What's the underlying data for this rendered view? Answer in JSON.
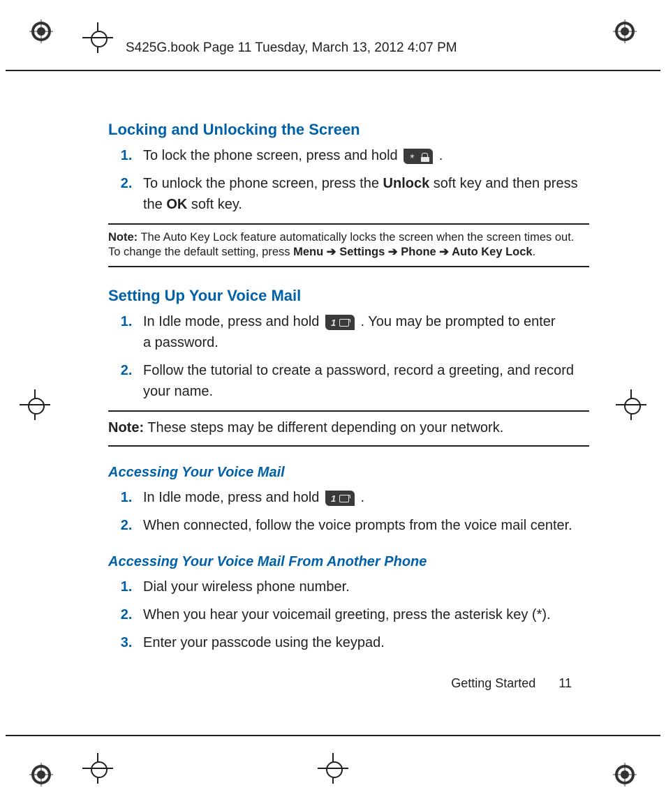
{
  "header": "S425G.book  Page 11  Tuesday, March 13, 2012  4:07 PM",
  "section1": {
    "title": "Locking and Unlocking the Screen",
    "items": {
      "i1a": "To lock the phone screen, press and hold ",
      "i1b": ".",
      "i2a": "To unlock the phone screen, press the ",
      "i2_unlock": "Unlock",
      "i2b": " soft key and then press the ",
      "i2_ok": "OK",
      "i2c": " soft key."
    },
    "note": {
      "label": "Note:",
      "a": " The Auto Key Lock feature automatically locks the screen when the screen times out. To change the default setting, press ",
      "m": "Menu",
      "arr": " ➔ ",
      "s": "Settings",
      "p": "Phone",
      "akl": "Auto Key Lock",
      "end": "."
    }
  },
  "section2": {
    "title": "Setting Up Your Voice Mail",
    "items": {
      "i1a": "In Idle mode, press and hold ",
      "i1b": ". You may be prompted to enter a password.",
      "i2": "Follow the tutorial to create a password, record a greeting, and record your name."
    },
    "note": {
      "label": "Note:",
      "body": " These steps may be different depending on your network."
    }
  },
  "section3": {
    "title": "Accessing Your Voice Mail",
    "items": {
      "i1a": "In Idle mode, press and hold ",
      "i1b": ".",
      "i2": "When connected, follow the voice prompts from the voice mail center."
    }
  },
  "section4": {
    "title": "Accessing Your Voice Mail From Another Phone",
    "items": {
      "i1": "Dial your wireless phone number.",
      "i2": "When you hear your voicemail greeting, press the asterisk key (*).",
      "i3": "Enter your passcode using the keypad."
    }
  },
  "footer": {
    "chapter": "Getting Started",
    "page": "11"
  }
}
